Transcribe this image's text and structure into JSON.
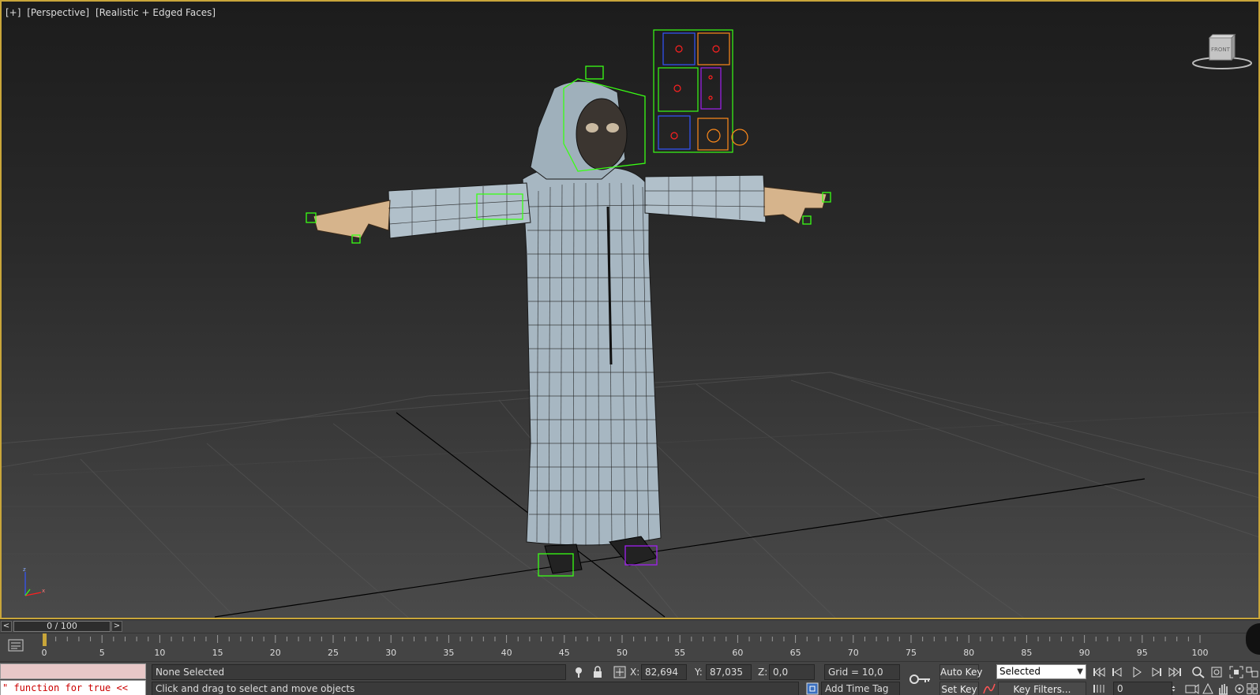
{
  "viewport": {
    "label_menu": "[+]",
    "label_view": "[Perspective]",
    "label_shading": "[Realistic + Edged Faces]",
    "viewcube_face": "FRONT",
    "axis_x": "x",
    "axis_z": "z"
  },
  "time_slider": {
    "prev_label": "<",
    "next_label": ">",
    "position": "0 / 100",
    "current_frame": 0,
    "total_frames": 100
  },
  "track_bar": {
    "tick_labels": [
      "0",
      "5",
      "10",
      "15",
      "20",
      "25",
      "30",
      "35",
      "40",
      "45",
      "50",
      "55",
      "60",
      "65",
      "70",
      "75",
      "80",
      "85",
      "90",
      "95",
      "100"
    ]
  },
  "status": {
    "listener_output": "\" function for true <<",
    "selection": "None Selected",
    "prompt": "Click and drag to select and move objects",
    "x_label": "X:",
    "x_value": "82,694",
    "y_label": "Y:",
    "y_value": "87,035",
    "z_label": "Z:",
    "z_value": "0,0",
    "grid": "Grid = 10,0",
    "add_time_tag": "Add Time Tag"
  },
  "animation": {
    "auto_key": "Auto Key",
    "set_key": "Set Key",
    "selection_set": "Selected",
    "key_filters": "Key Filters...",
    "frame_value": "0"
  },
  "colors": {
    "viewport_border": "#c9a63a",
    "panel_bg": "#444444",
    "listener_top": "#e8c8c8",
    "listener_text": "#cc0000",
    "rig_green": "#39ff14",
    "ui_board_orange": "#ff8a1a"
  }
}
